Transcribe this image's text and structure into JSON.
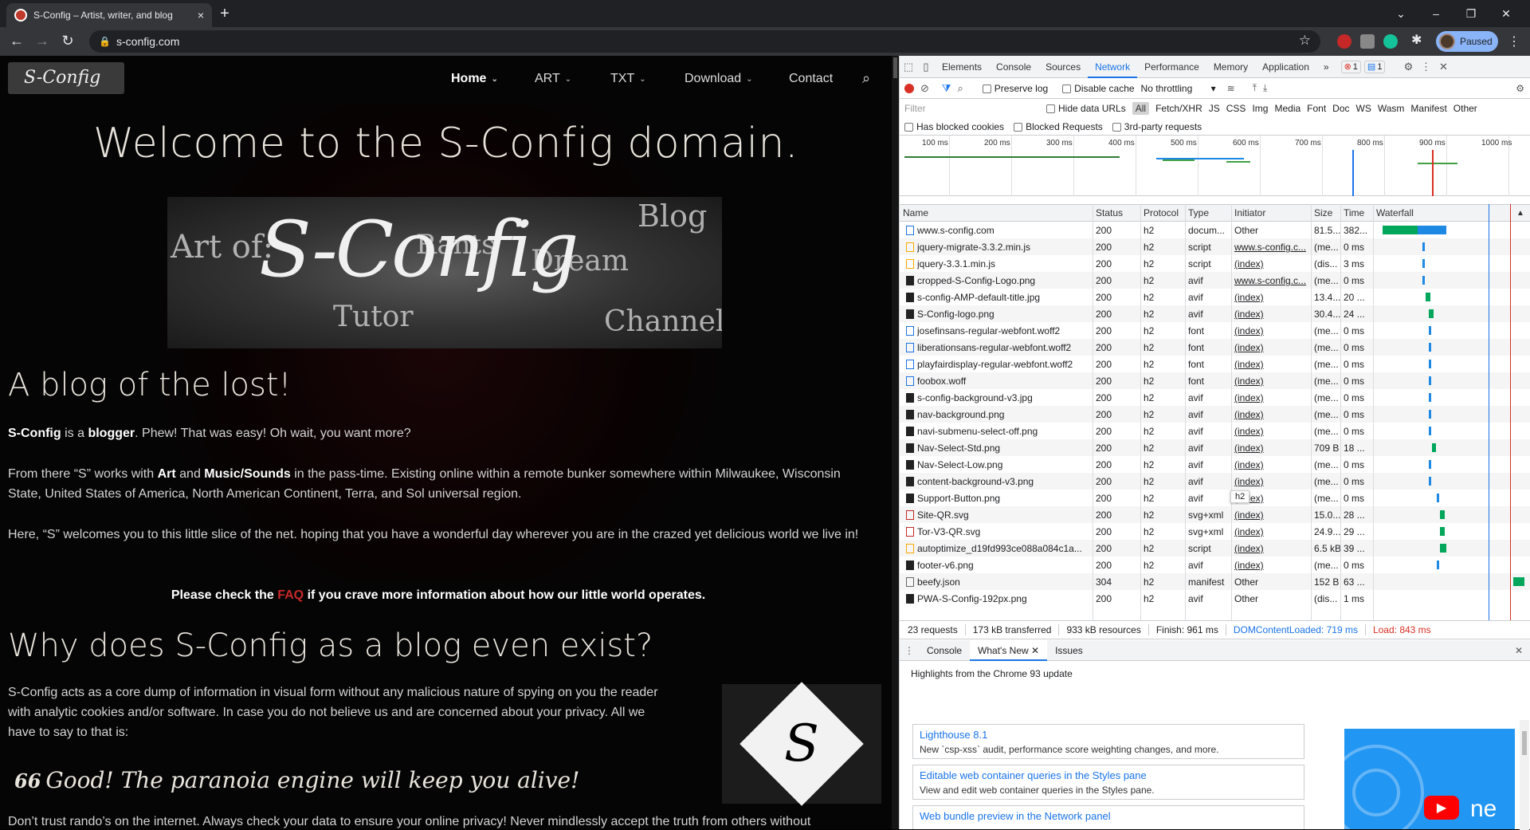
{
  "browser": {
    "tab_title": "S-Config – Artist, writer, and blog",
    "url": "s-config.com",
    "profile_label": "Paused",
    "new_tab": "+",
    "close_tab": "×",
    "window_controls": [
      "⌄",
      "–",
      "❐",
      "✕"
    ]
  },
  "site": {
    "logo_text": "S-Config",
    "nav": [
      {
        "label": "Home"
      },
      {
        "label": "ART"
      },
      {
        "label": "TXT"
      },
      {
        "label": "Download"
      },
      {
        "label": "Contact"
      }
    ],
    "heading": "Welcome to the S-Config domain.",
    "banner": {
      "big": "S-Config",
      "art_of": "Art of:",
      "blog": "Blog",
      "rants": "Rants",
      "dream": "Dream",
      "tutor": "Tutor",
      "channel": "Channel"
    },
    "h2_a": "A blog of the lost!",
    "p1_a": "S-Config",
    "p1_b": " is a ",
    "p1_c": "blogger",
    "p1_d": ". Phew! That was easy! Oh wait, you want more?",
    "p2_a": "From there “S” works with ",
    "p2_b": "Art",
    "p2_c": " and ",
    "p2_d": "Music/Sounds",
    "p2_e": " in the pass-time. Existing online within a remote bunker somewhere within Milwaukee, Wisconsin State, United States of America, North American Continent, Terra, and Sol universal region.",
    "p3": "Here, “S” welcomes you to this little slice of the net. hoping that you have a wonderful day wherever you are in the crazed yet delicious world we live in!",
    "p4_a": "Please check the ",
    "p4_faq": "FAQ",
    "p4_b": " if you crave more information about how our little world operates.",
    "h2_b": "Why does S-Config as a blog even exist?",
    "p5": "S-Config acts as a core dump of information in visual form without any malicious nature of spying on you the reader with analytic cookies and/or software. In case you do not believe us and are concerned about your privacy. All we have to say to that is:",
    "quote_mark": "66",
    "quote": "Good! The paranoia engine will keep you alive!",
    "p6": "Don’t trust rando’s on the internet. Always check your data to ensure your online privacy! Never mindlessly accept the truth from others without",
    "qlogo": "S"
  },
  "devtools": {
    "tabs": [
      "Elements",
      "Console",
      "Sources",
      "Network",
      "Performance",
      "Memory",
      "Application"
    ],
    "active_tab": "Network",
    "more_tabs": "»",
    "error_count": "1",
    "msg_count": "1",
    "preserve_log": "Preserve log",
    "disable_cache": "Disable cache",
    "throttle": "No throttling",
    "filter_placeholder": "Filter",
    "hide_data_urls": "Hide data URLs",
    "type_filters": [
      "All",
      "Fetch/XHR",
      "JS",
      "CSS",
      "Img",
      "Media",
      "Font",
      "Doc",
      "WS",
      "Wasm",
      "Manifest",
      "Other"
    ],
    "has_blocked_cookies": "Has blocked cookies",
    "blocked_requests": "Blocked Requests",
    "third_party": "3rd-party requests",
    "ticks": [
      "100 ms",
      "200 ms",
      "300 ms",
      "400 ms",
      "500 ms",
      "600 ms",
      "700 ms",
      "800 ms",
      "900 ms",
      "1000 ms"
    ],
    "columns": [
      "Name",
      "Status",
      "Protocol",
      "Type",
      "Initiator",
      "Size",
      "Time",
      "Waterfall"
    ],
    "rows": [
      {
        "name": "www.s-config.com",
        "status": "200",
        "protocol": "h2",
        "type": "docum...",
        "initiator": "Other",
        "size": "81.5...",
        "time": "382..."
      },
      {
        "name": "jquery-migrate-3.3.2.min.js",
        "status": "200",
        "protocol": "h2",
        "type": "script",
        "initiator": "www.s-config.c...",
        "size": "(me...",
        "time": "0 ms"
      },
      {
        "name": "jquery-3.3.1.min.js",
        "status": "200",
        "protocol": "h2",
        "type": "script",
        "initiator": "(index)",
        "size": "(dis...",
        "time": "3 ms"
      },
      {
        "name": "cropped-S-Config-Logo.png",
        "status": "200",
        "protocol": "h2",
        "type": "avif",
        "initiator": "www.s-config.c...",
        "size": "(me...",
        "time": "0 ms"
      },
      {
        "name": "s-config-AMP-default-title.jpg",
        "status": "200",
        "protocol": "h2",
        "type": "avif",
        "initiator": "(index)",
        "size": "13.4...",
        "time": "20 ..."
      },
      {
        "name": "S-Config-logo.png",
        "status": "200",
        "protocol": "h2",
        "type": "avif",
        "initiator": "(index)",
        "size": "30.4...",
        "time": "24 ..."
      },
      {
        "name": "josefinsans-regular-webfont.woff2",
        "status": "200",
        "protocol": "h2",
        "type": "font",
        "initiator": "(index)",
        "size": "(me...",
        "time": "0 ms"
      },
      {
        "name": "liberationsans-regular-webfont.woff2",
        "status": "200",
        "protocol": "h2",
        "type": "font",
        "initiator": "(index)",
        "size": "(me...",
        "time": "0 ms"
      },
      {
        "name": "playfairdisplay-regular-webfont.woff2",
        "status": "200",
        "protocol": "h2",
        "type": "font",
        "initiator": "(index)",
        "size": "(me...",
        "time": "0 ms"
      },
      {
        "name": "foobox.woff",
        "status": "200",
        "protocol": "h2",
        "type": "font",
        "initiator": "(index)",
        "size": "(me...",
        "time": "0 ms"
      },
      {
        "name": "s-config-background-v3.jpg",
        "status": "200",
        "protocol": "h2",
        "type": "avif",
        "initiator": "(index)",
        "size": "(me...",
        "time": "0 ms"
      },
      {
        "name": "nav-background.png",
        "status": "200",
        "protocol": "h2",
        "type": "avif",
        "initiator": "(index)",
        "size": "(me...",
        "time": "0 ms"
      },
      {
        "name": "navi-submenu-select-off.png",
        "status": "200",
        "protocol": "h2",
        "type": "avif",
        "initiator": "(index)",
        "size": "(me...",
        "time": "0 ms"
      },
      {
        "name": "Nav-Select-Std.png",
        "status": "200",
        "protocol": "h2",
        "type": "avif",
        "initiator": "(index)",
        "size": "709 B",
        "time": "18 ..."
      },
      {
        "name": "Nav-Select-Low.png",
        "status": "200",
        "protocol": "h2",
        "type": "avif",
        "initiator": "(index)",
        "size": "(me...",
        "time": "0 ms"
      },
      {
        "name": "content-background-v3.png",
        "status": "200",
        "protocol": "h2",
        "type": "avif",
        "initiator": "(index)",
        "size": "(me...",
        "time": "0 ms"
      },
      {
        "name": "Support-Button.png",
        "status": "200",
        "protocol": "h2",
        "type": "avif",
        "initiator": "(index)",
        "size": "(me...",
        "time": "0 ms"
      },
      {
        "name": "Site-QR.svg",
        "status": "200",
        "protocol": "h2",
        "type": "svg+xml",
        "initiator": "(index)",
        "size": "15.0...",
        "time": "28 ..."
      },
      {
        "name": "Tor-V3-QR.svg",
        "status": "200",
        "protocol": "h2",
        "type": "svg+xml",
        "initiator": "(index)",
        "size": "24.9...",
        "time": "29 ..."
      },
      {
        "name": "autoptimize_d19fd993ce088a084c1a...",
        "status": "200",
        "protocol": "h2",
        "type": "script",
        "initiator": "(index)",
        "size": "6.5 kB",
        "time": "39 ..."
      },
      {
        "name": "footer-v6.png",
        "status": "200",
        "protocol": "h2",
        "type": "avif",
        "initiator": "(index)",
        "size": "(me...",
        "time": "0 ms"
      },
      {
        "name": "beefy.json",
        "status": "304",
        "protocol": "h2",
        "type": "manifest",
        "initiator": "Other",
        "size": "152 B",
        "time": "63 ..."
      },
      {
        "name": "PWA-S-Config-192px.png",
        "status": "200",
        "protocol": "h2",
        "type": "avif",
        "initiator": "Other",
        "size": "(dis...",
        "time": "1 ms"
      }
    ],
    "tooltip": "h2",
    "summary": {
      "requests": "23 requests",
      "transferred": "173 kB transferred",
      "resources": "933 kB resources",
      "finish": "Finish: 961 ms",
      "dcl": "DOMContentLoaded: 719 ms",
      "load": "Load: 843 ms"
    },
    "drawer_tabs": [
      "Console",
      "What's New",
      "Issues"
    ],
    "drawer_active": "What's New",
    "whats_new_title": "Highlights from the Chrome 93 update",
    "cards": [
      {
        "title": "Lighthouse 8.1",
        "desc": "New `csp-xss` audit, performance score weighting changes, and more."
      },
      {
        "title": "Editable web container queries in the Styles pane",
        "desc": "View and edit web container queries in the Styles pane."
      },
      {
        "title": "Web bundle preview in the Network panel",
        "desc": ""
      }
    ],
    "video_text": "ne"
  },
  "colors": {
    "accent": "#1a73e8",
    "error": "#d93025",
    "faq_link": "#c62828"
  }
}
